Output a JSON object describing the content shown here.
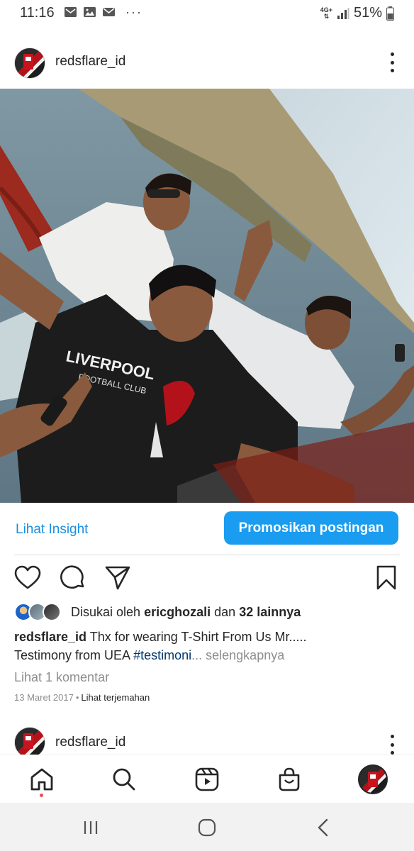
{
  "status_bar": {
    "time": "11:16",
    "network": "4G+",
    "battery": "51%"
  },
  "post": {
    "username": "redsflare_id",
    "insight_link": "Lihat Insight",
    "promote_button": "Promosikan postingan",
    "likes": {
      "prefix": "Disukai oleh",
      "liker": "ericghozali",
      "connector": "dan",
      "others": "32 lainnya"
    },
    "caption": {
      "username": "redsflare_id",
      "text_line1": "Thx for wearing T-Shirt From Us Mr.....",
      "text_line2": "Testimony from UEA",
      "hashtag": "#testimoni",
      "ellipsis": "...",
      "more": "selengkapnya"
    },
    "comments_link": "Lihat 1 komentar",
    "date": "13 Maret 2017",
    "separator": "•",
    "translate_link": "Lihat terjemahan"
  },
  "next_post": {
    "username": "redsflare_id"
  },
  "icons": {
    "like": "heart-icon",
    "comment": "comment-icon",
    "share": "send-icon",
    "save": "bookmark-icon",
    "home": "home-icon",
    "search": "search-icon",
    "reels": "reels-icon",
    "shop": "shop-icon",
    "profile": "profile-avatar"
  },
  "colors": {
    "accent": "#1a9cf0",
    "link": "#1a8fe3",
    "hashtag": "#00376b",
    "muted": "#8e8e8e",
    "notification_dot": "#ed4956"
  }
}
